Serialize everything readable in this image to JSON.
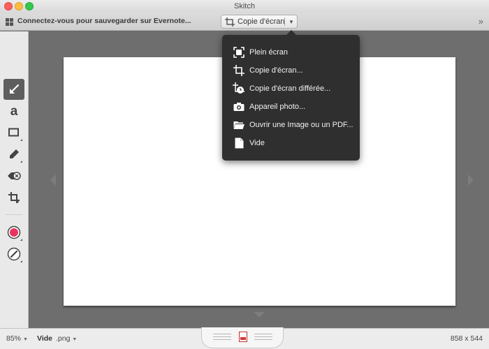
{
  "window": {
    "title": "Skitch"
  },
  "toolbar": {
    "evernote_text": "Connectez-vous pour sauvegarder sur Evernote...",
    "capture_label": "Copie d'écran",
    "capture_caret": "▼",
    "more": "»"
  },
  "tools": [
    {
      "name": "arrow-tool",
      "icon": "arrow-icon",
      "active": true
    },
    {
      "name": "text-tool",
      "icon": "text-a-icon",
      "label": "a"
    },
    {
      "name": "shape-tool",
      "icon": "rectangle-icon"
    },
    {
      "name": "marker-tool",
      "icon": "marker-icon"
    },
    {
      "name": "pixelate-tool",
      "icon": "eraser-icon"
    },
    {
      "name": "crop-tool",
      "icon": "crop-icon"
    },
    {
      "name": "color-picker",
      "icon": "color-dot-icon",
      "color": "#e8335e"
    },
    {
      "name": "stroke-size",
      "icon": "pen-size-icon"
    }
  ],
  "menu": {
    "items": [
      {
        "label": "Plein écran",
        "icon": "fullscreen-icon"
      },
      {
        "label": "Copie d'écran...",
        "icon": "crop-icon"
      },
      {
        "label": "Copie d'écran différée...",
        "icon": "timer-crop-icon"
      },
      {
        "label": "Appareil photo...",
        "icon": "camera-icon"
      },
      {
        "label": "Ouvrir une Image ou un PDF...",
        "icon": "folder-icon"
      },
      {
        "label": "Vide",
        "icon": "blank-file-icon"
      }
    ]
  },
  "status": {
    "zoom": "85%",
    "filename": "Vide",
    "extension": ".png",
    "dimensions": "858 x 544"
  },
  "colors": {
    "active_color": "#e8335e",
    "menu_bg": "#2f2f2f"
  }
}
